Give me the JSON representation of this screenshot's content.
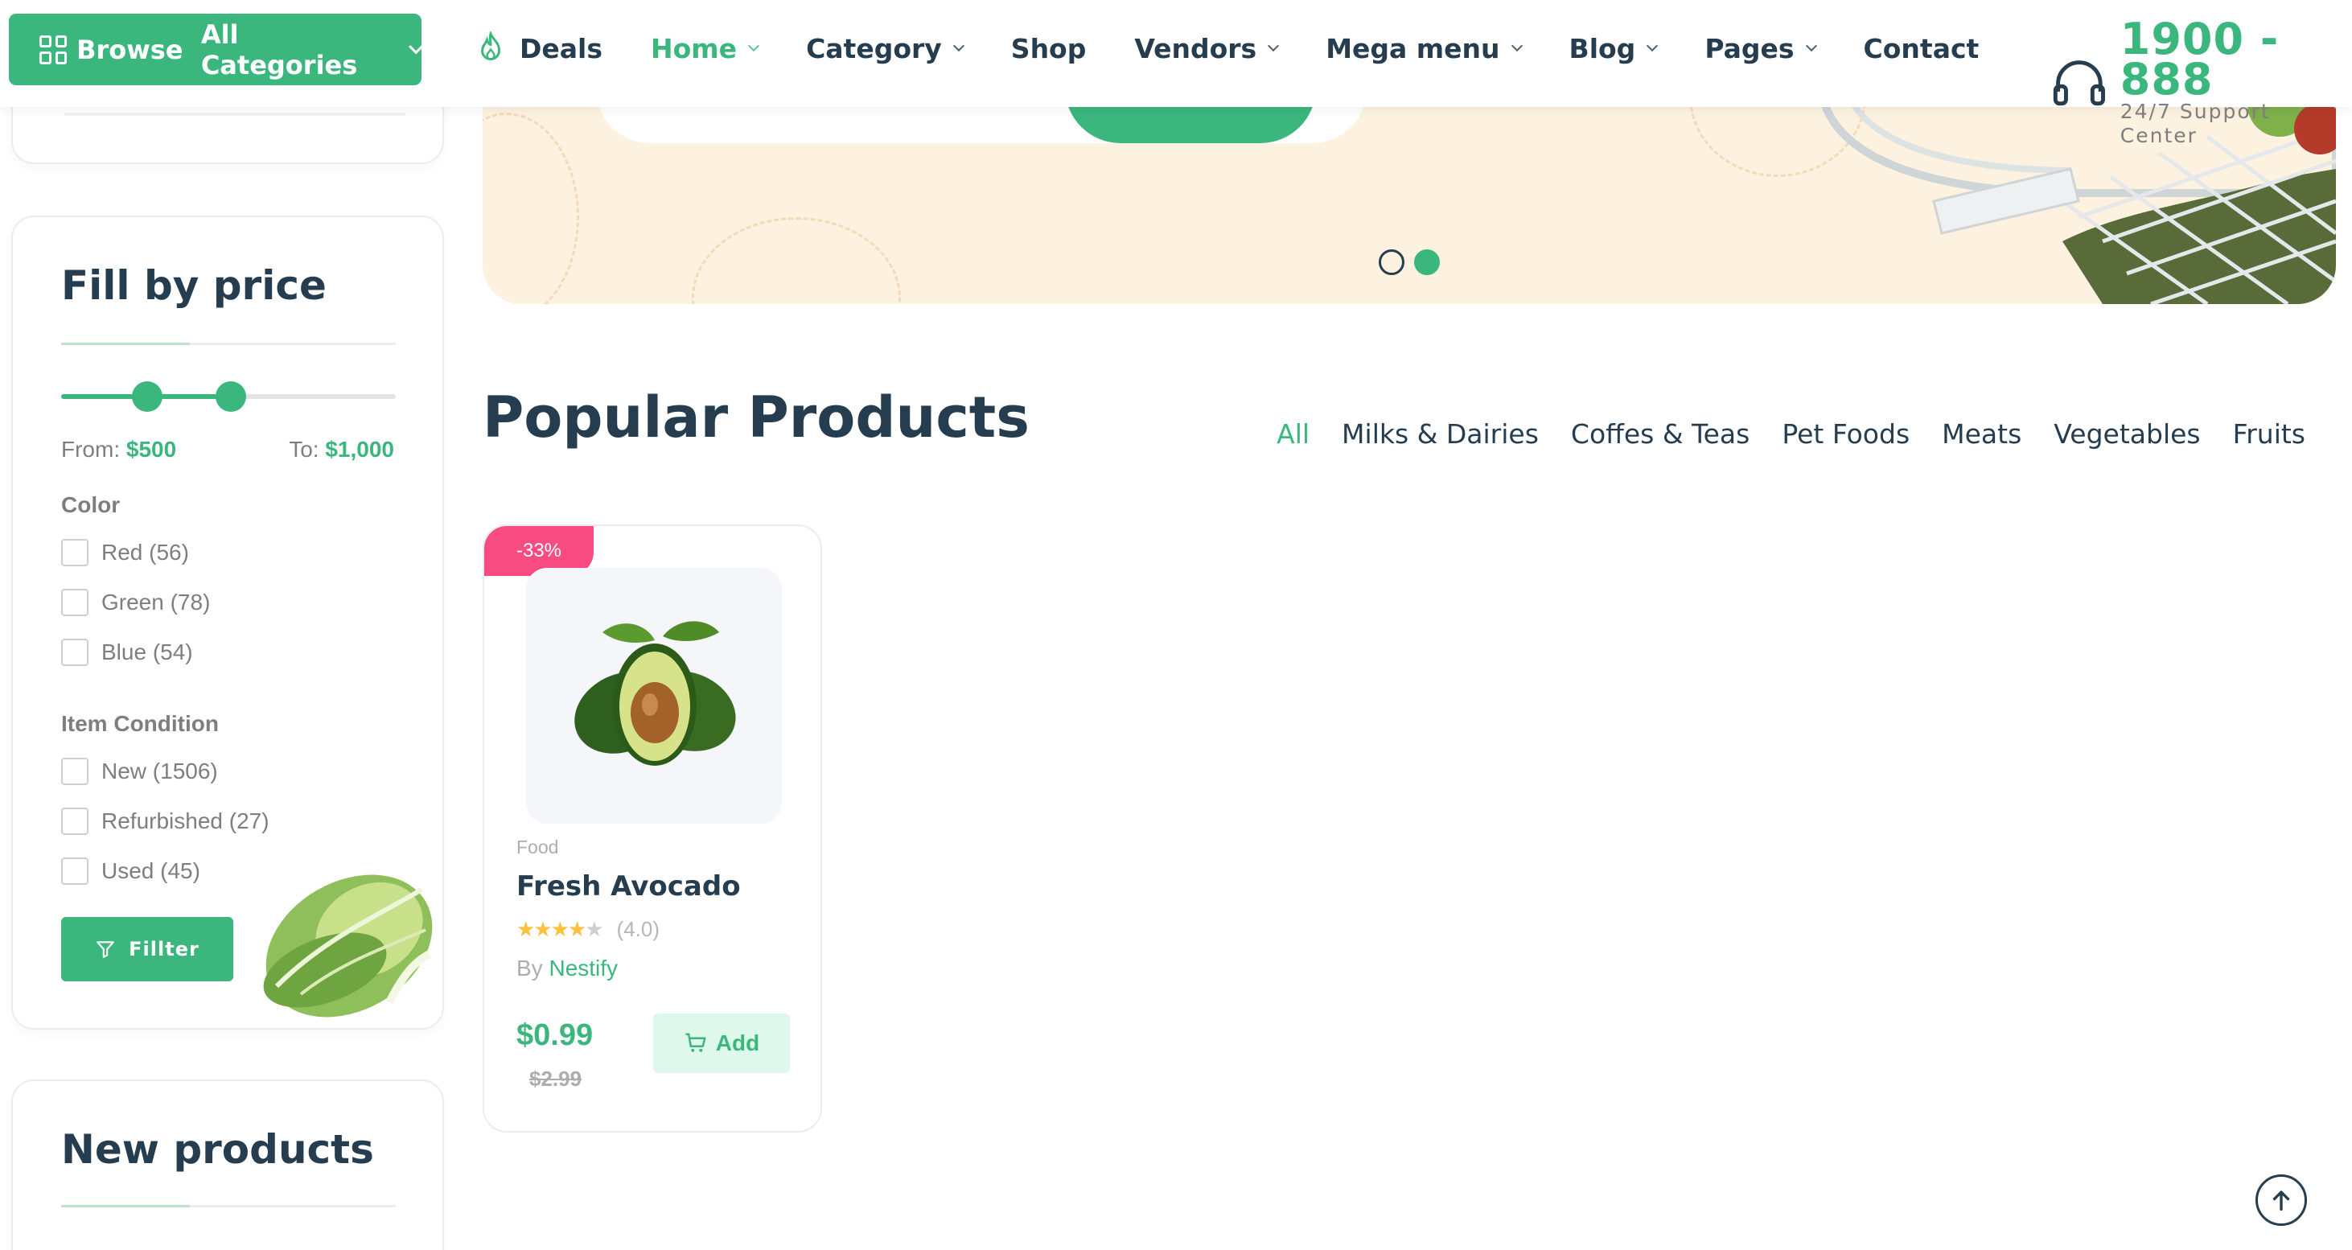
{
  "header": {
    "browse_label": "Browse",
    "browse_label_2": "All Categories",
    "nav": [
      {
        "label": "Deals",
        "active": false
      },
      {
        "label": "Home",
        "active": true
      },
      {
        "label": "Category",
        "active": false
      },
      {
        "label": "Shop",
        "active": false
      },
      {
        "label": "Vendors",
        "active": false
      },
      {
        "label": "Mega menu",
        "active": false
      },
      {
        "label": "Blog",
        "active": false
      },
      {
        "label": "Pages",
        "active": false
      },
      {
        "label": "Contact",
        "active": false
      }
    ],
    "support_number": "1900 - 888",
    "support_label": "24/7 Support Center"
  },
  "sidebar": {
    "price_title": "Fill by price",
    "from_label": "From:",
    "from_value": "$500",
    "to_label": "To:",
    "to_value": "$1,000",
    "color_title": "Color",
    "colors": [
      "Red (56)",
      "Green (78)",
      "Blue (54)"
    ],
    "condition_title": "Item Condition",
    "conditions": [
      "New (1506)",
      "Refurbished (27)",
      "Used (45)"
    ],
    "filter_label": "Fillter",
    "new_products_title": "New products"
  },
  "banner": {
    "slides": 2,
    "active_slide": 2
  },
  "popular": {
    "title": "Popular Products",
    "tabs": [
      "All",
      "Milks & Dairies",
      "Coffes & Teas",
      "Pet Foods",
      "Meats",
      "Vegetables",
      "Fruits"
    ],
    "active_tab": "All"
  },
  "product": {
    "badge": "-33%",
    "category": "Food",
    "name": "Fresh Avocado",
    "rating_text": "(4.0)",
    "rating": 4.0,
    "by_label": "By",
    "vendor": "Nestify",
    "price": "$0.99",
    "old_price": "$2.99",
    "add_label": "Add"
  },
  "colors": {
    "brand": "#3bb77e",
    "text": "#253d4e",
    "badge": "#f74b81",
    "banner_bg": "#fdf2df"
  }
}
